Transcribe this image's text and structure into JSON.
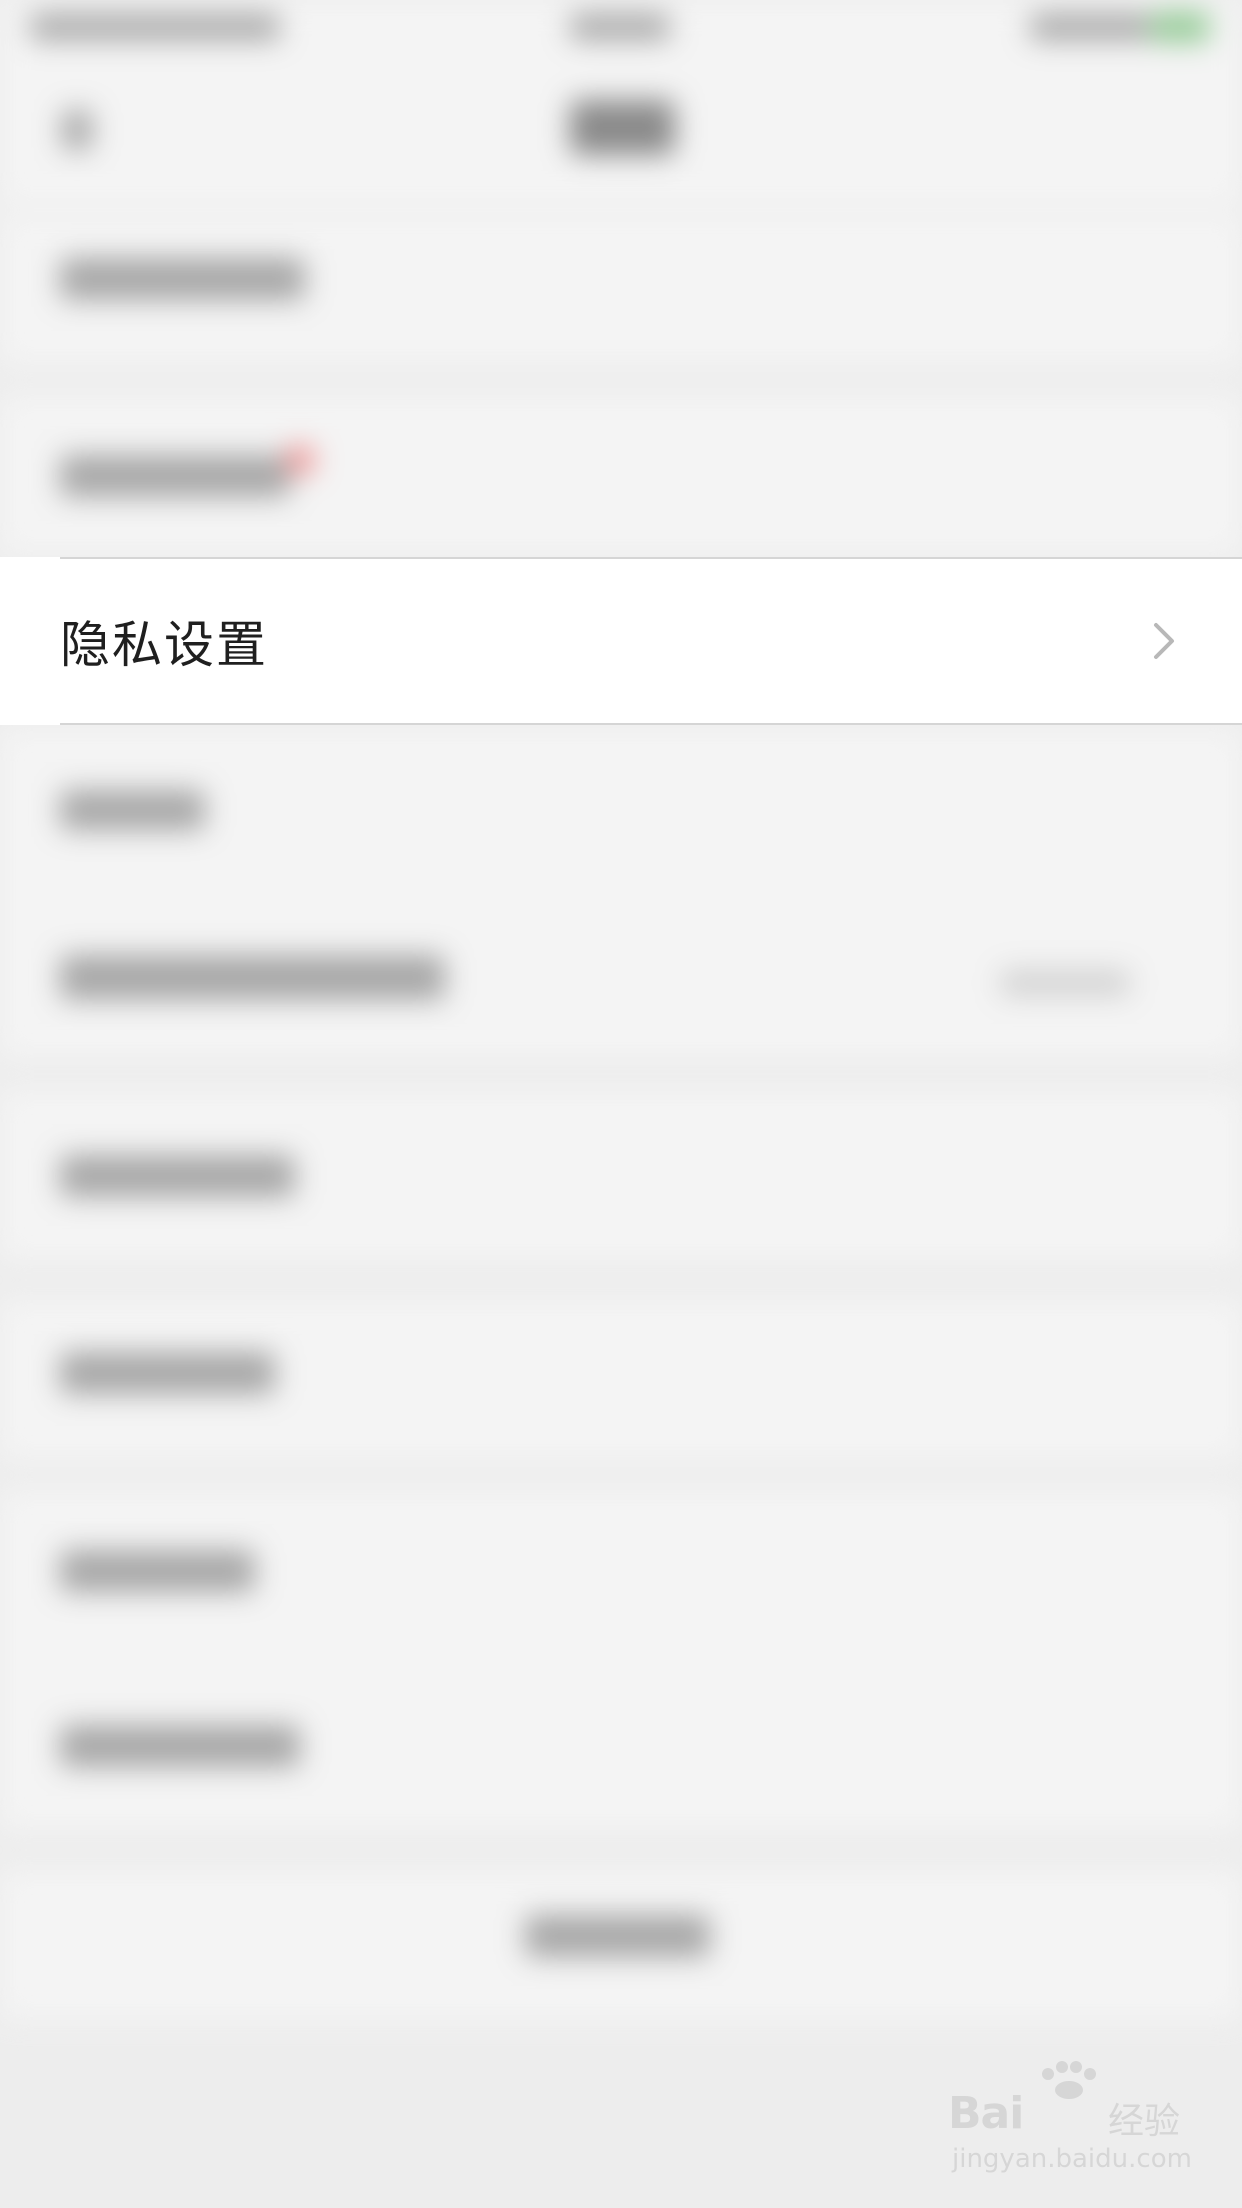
{
  "privacy_row": {
    "label": "隐私设置"
  },
  "watermark": {
    "brand": "Bai",
    "brand_cn": "经验",
    "url": "jingyan.baidu.com"
  },
  "colors": {
    "background": "#ededed",
    "row_background": "#ffffff",
    "text": "#1f1f1f",
    "divider": "#d5d5d5",
    "chevron": "#b8b8b8",
    "badge": "#f24b4b"
  }
}
